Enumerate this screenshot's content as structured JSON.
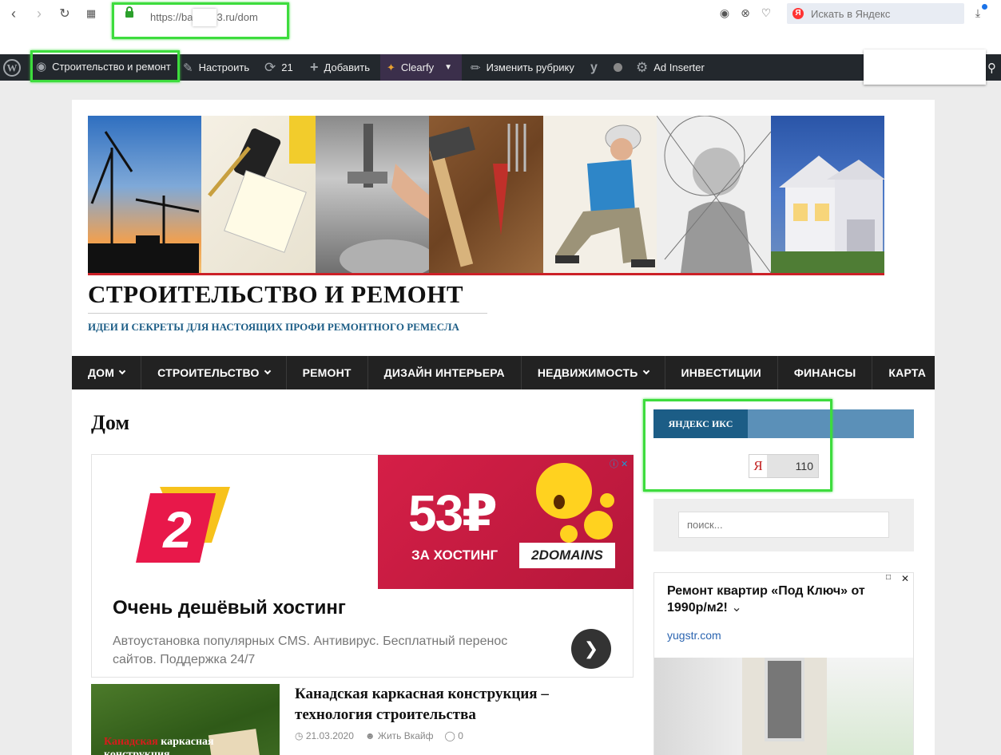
{
  "browser": {
    "url_prefix": "https://ba",
    "url_suffix": "3.ru/dom",
    "search_placeholder": "Искать в Яндекс",
    "yandex_letter": "Я"
  },
  "adminbar": {
    "site_name": "Строительство и ремонт",
    "customize": "Настроить",
    "updates_count": "21",
    "add_new": "Добавить",
    "clearfy": "Clearfy",
    "edit_category": "Изменить рубрику",
    "ad_inserter": "Ad Inserter"
  },
  "site": {
    "title": "СТРОИТЕЛЬСТВО И РЕМОНТ",
    "description": "ИДЕИ И СЕКРЕТЫ ДЛЯ НАСТОЯЩИХ ПРОФИ РЕМОНТНОГО РЕМЕСЛА"
  },
  "nav": {
    "items": [
      {
        "label": "ДОМ",
        "has_children": true
      },
      {
        "label": "СТРОИТЕЛЬСТВО",
        "has_children": true
      },
      {
        "label": "РЕМОНТ",
        "has_children": false
      },
      {
        "label": "ДИЗАЙН ИНТЕРЬЕРА",
        "has_children": false
      },
      {
        "label": "НЕДВИЖИМОСТЬ",
        "has_children": true
      },
      {
        "label": "ИНВЕСТИЦИИ",
        "has_children": false
      },
      {
        "label": "ФИНАНСЫ",
        "has_children": false
      },
      {
        "label": "КАРТА",
        "has_children": false
      }
    ]
  },
  "main": {
    "category_title": "Дом",
    "ad": {
      "price": "53₽",
      "hosting_label": "ЗА ХОСТИНГ",
      "brand": "2DOMAINS",
      "logo_digit": "2",
      "headline": "Очень дешёвый хостинг",
      "description": "Автоустановка популярных CMS. Антивирус. Бесплатный перенос сайтов. Поддержка 24/7"
    },
    "post": {
      "title": "Канадская каркасная конструкция – технология строительства",
      "date": "21.03.2020",
      "author": "Жить Вкайф",
      "comments": "0",
      "thumb_text_red": "Канадская",
      "thumb_text_white": "каркасная конструкция"
    }
  },
  "sidebar": {
    "yandex_widget_title": "ЯНДЕКС ИКС",
    "yandex_letter": "Я",
    "yandex_iks_value": "110",
    "search_placeholder": "поиск...",
    "ad": {
      "title": "Ремонт квартир «Под Ключ» от 1990р/м2!",
      "domain": "yugstr.com"
    }
  },
  "colors": {
    "highlight": "#3ddc3d",
    "accent_blue": "#1c5d86",
    "accent_red": "#cc2027",
    "nav_bg": "#222222",
    "adminbar_bg": "#23282d"
  }
}
